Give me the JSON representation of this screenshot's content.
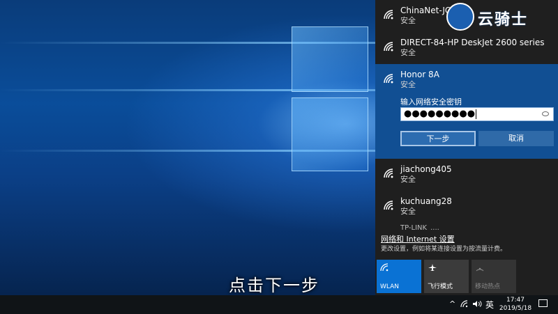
{
  "caption": "点击下一步",
  "watermark": {
    "text": "云骑士"
  },
  "networks": [
    {
      "ssid": "ChinaNet-JC",
      "status": "安全"
    },
    {
      "ssid": "DIRECT-84-HP DeskJet 2600 series",
      "status": "安全"
    },
    {
      "ssid": "Honor 8A",
      "status": "安全",
      "expanded": true
    },
    {
      "ssid": "jiachong405",
      "status": "安全"
    },
    {
      "ssid": "kuchuang28",
      "status": "安全"
    }
  ],
  "password_prompt": {
    "label": "输入网络安全密钥",
    "masked_value": "●●●●●●●●●",
    "next_label": "下一步",
    "cancel_label": "取消"
  },
  "partial_network": "TP-LINK_....",
  "settings": {
    "link": "网络和 Internet 设置",
    "description": "更改设置，例如将某连接设置为按流量计费。"
  },
  "quick_actions": [
    {
      "label": "WLAN",
      "icon": "wifi-icon",
      "state": "on"
    },
    {
      "label": "飞行模式",
      "icon": "airplane-icon",
      "state": "off"
    },
    {
      "label": "移动热点",
      "icon": "hotspot-icon",
      "state": "disabled"
    }
  ],
  "taskbar": {
    "ime": "英",
    "time": "17:47",
    "date": "2019/5/18"
  },
  "colors": {
    "accent": "#0a72d4",
    "selected_network": "#114f93",
    "flyout_bg": "#1f1f1f"
  }
}
